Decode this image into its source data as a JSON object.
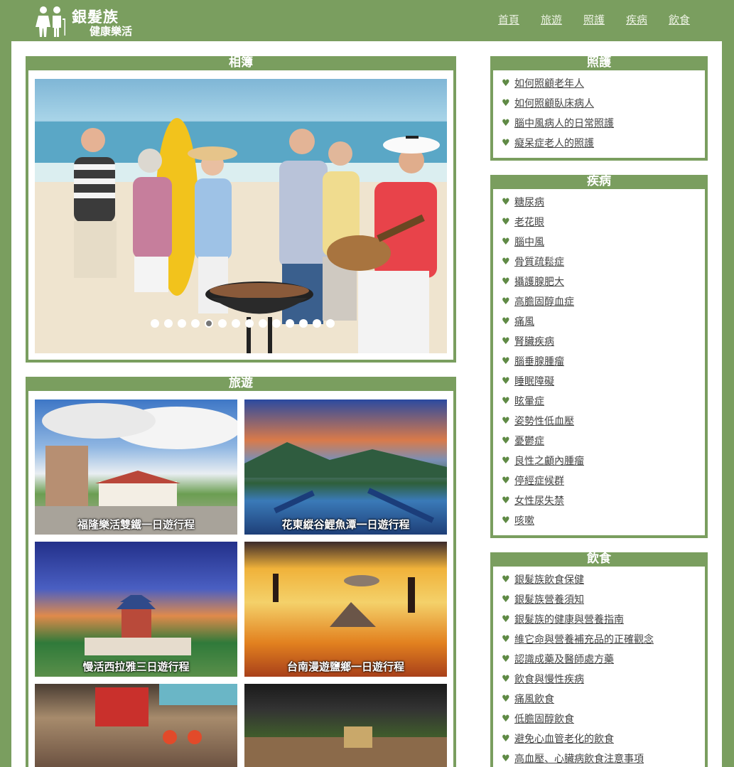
{
  "header": {
    "title": "銀髮族",
    "subtitle": "健康樂活",
    "nav": [
      "首頁",
      "旅遊",
      "照護",
      "疾病",
      "飲食"
    ]
  },
  "colors": {
    "theme": "#7a9e5f",
    "background": "#ffffff"
  },
  "album": {
    "title": "相簿",
    "slide_count": 14,
    "active_slide": 5
  },
  "travel": {
    "title": "旅遊",
    "tiles": [
      {
        "caption": "福隆樂活雙鐵一日遊行程"
      },
      {
        "caption": "花東縱谷鯉魚潭一日遊行程"
      },
      {
        "caption": "慢活西拉雅三日遊行程"
      },
      {
        "caption": "台南漫遊鹽鄉一日遊行程"
      },
      {
        "caption": ""
      },
      {
        "caption": ""
      }
    ]
  },
  "care": {
    "title": "照護",
    "items": [
      "如何照顧老年人",
      "如何照顧臥床病人",
      "腦中風病人的日常照護",
      "癡呆症老人的照護"
    ]
  },
  "disease": {
    "title": "疾病",
    "items": [
      "糖尿病",
      "老花眼",
      "腦中風",
      "骨質疏鬆症",
      "攝護腺肥大",
      "高膽固醇血症",
      "痛風",
      "腎臟疾病",
      "腦垂腺腫瘤",
      "睡眠障礙",
      "眩暈症",
      "姿勢性低血壓",
      "憂鬱症",
      "良性之顱內腫瘤",
      "停經症候群",
      "女性尿失禁",
      "咳嗽"
    ]
  },
  "diet": {
    "title": "飲食",
    "items": [
      "銀髮族飲食保健",
      "銀髮族營養須知",
      "銀髮族的健康與營養指南",
      "維它命與營養補充品的正確觀念",
      "認識成藥及醫師處方藥",
      "飲食與慢性疾病",
      "痛風飲食",
      "低膽固醇飲食",
      "避免心血管老化的飲食",
      "高血壓、心臟病飲食注意事項"
    ]
  }
}
